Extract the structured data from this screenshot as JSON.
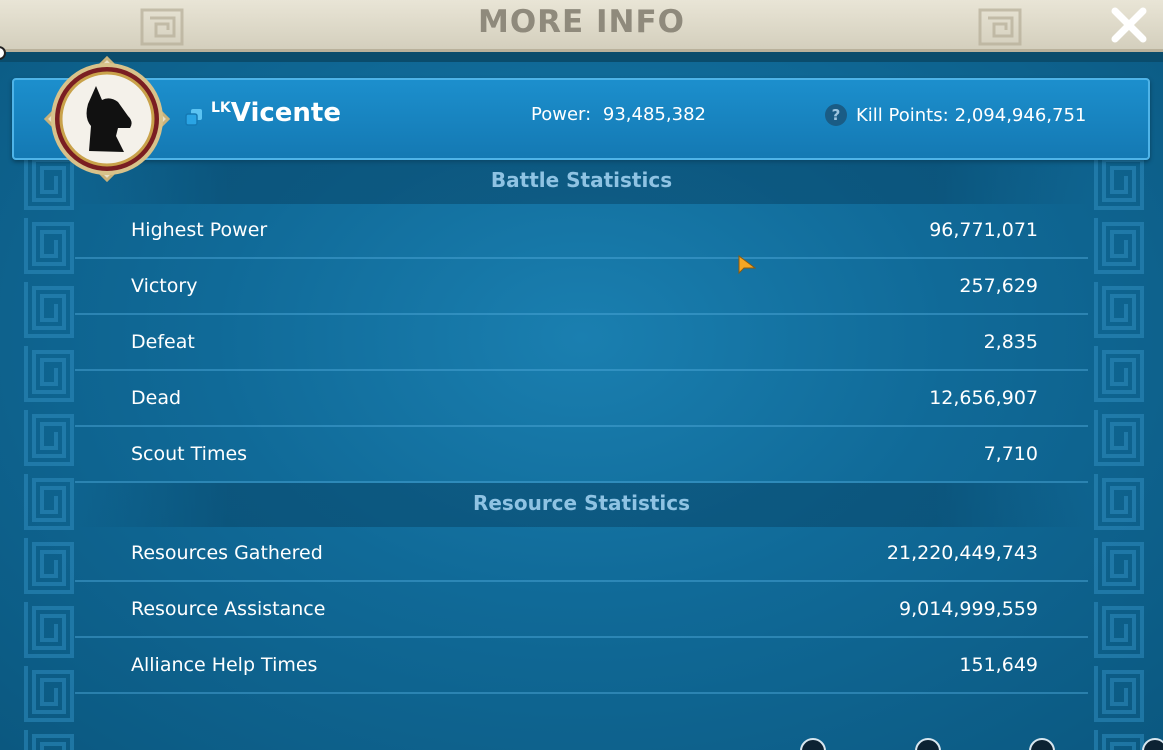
{
  "window": {
    "title": "MORE INFO"
  },
  "player": {
    "tag": "LK",
    "name": "Vicente",
    "power_label": "Power:",
    "power": "93,485,382",
    "kill_points_label": "Kill Points:",
    "kill_points": "2,094,946,751"
  },
  "battle": {
    "title": "Battle Statistics",
    "rows": [
      {
        "label": "Highest Power",
        "value": "96,771,071"
      },
      {
        "label": "Victory",
        "value": "257,629"
      },
      {
        "label": "Defeat",
        "value": "2,835"
      },
      {
        "label": "Dead",
        "value": "12,656,907"
      },
      {
        "label": "Scout Times",
        "value": "7,710"
      }
    ]
  },
  "resource": {
    "title": "Resource Statistics",
    "rows": [
      {
        "label": "Resources Gathered",
        "value": "21,220,449,743"
      },
      {
        "label": "Resource Assistance",
        "value": "9,014,999,559"
      },
      {
        "label": "Alliance Help Times",
        "value": "151,649"
      }
    ]
  },
  "icons": {
    "close": "close-icon",
    "avatar": "dog-avatar-icon",
    "copy": "copy-icon",
    "help": "help-icon"
  },
  "colors": {
    "panel": "#106a98",
    "header": "#1c8fcd",
    "section_title": "#8fc3e3",
    "titlebar": "#e9e5d6"
  }
}
